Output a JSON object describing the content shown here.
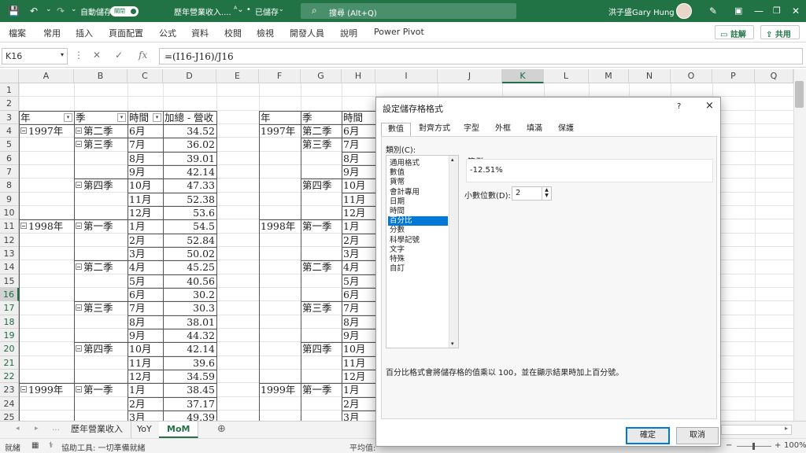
{
  "titlebar": {
    "autosave_label": "自動儲存",
    "autosave_state": "關閉",
    "doc_title": "歷年營業收入....",
    "saved_status": "已儲存",
    "search_placeholder": "搜尋 (Alt+Q)",
    "user_name": "洪子盛Gary Hung"
  },
  "ribbon": {
    "tabs": [
      "檔案",
      "常用",
      "插入",
      "頁面配置",
      "公式",
      "資料",
      "校閱",
      "檢視",
      "開發人員",
      "說明",
      "Power Pivot"
    ],
    "comments_label": "註解",
    "share_label": "共用"
  },
  "formula_bar": {
    "name_box": "K16",
    "formula": "=(I16-J16)/J16",
    "fx": "fx"
  },
  "columns": [
    "A",
    "B",
    "C",
    "D",
    "E",
    "F",
    "G",
    "H",
    "I",
    "J",
    "K",
    "L",
    "M",
    "N",
    "O",
    "P",
    "Q"
  ],
  "rows": [
    "1",
    "2",
    "3",
    "4",
    "5",
    "6",
    "7",
    "8",
    "9",
    "10",
    "11",
    "12",
    "13",
    "14",
    "15",
    "16",
    "17",
    "18",
    "19",
    "20",
    "21",
    "22",
    "23",
    "24",
    "25"
  ],
  "selected_cell": {
    "column": "K",
    "row": "16"
  },
  "pivot_left": {
    "headers": {
      "year": "年",
      "quarter": "季",
      "time": "時間",
      "sum": "加總 - 營收"
    },
    "years": [
      {
        "label": "1997年",
        "row": 4
      },
      {
        "label": "1998年",
        "row": 11
      },
      {
        "label": "1999年",
        "row": 23
      }
    ],
    "quarters": [
      {
        "label": "第二季",
        "row": 4
      },
      {
        "label": "第三季",
        "row": 5
      },
      {
        "label": "第四季",
        "row": 8
      },
      {
        "label": "第一季",
        "row": 11
      },
      {
        "label": "第二季",
        "row": 14
      },
      {
        "label": "第三季",
        "row": 17
      },
      {
        "label": "第四季",
        "row": 20
      },
      {
        "label": "第一季",
        "row": 23
      }
    ],
    "months": [
      "6月",
      "7月",
      "8月",
      "9月",
      "10月",
      "11月",
      "12月",
      "1月",
      "2月",
      "3月",
      "4月",
      "5月",
      "6月",
      "7月",
      "8月",
      "9月",
      "10月",
      "11月",
      "12月",
      "1月",
      "2月",
      "3月"
    ],
    "values": [
      "34.52",
      "36.02",
      "39.01",
      "42.14",
      "47.33",
      "52.38",
      "53.6",
      "54.5",
      "52.84",
      "50.02",
      "45.25",
      "40.56",
      "30.2",
      "30.3",
      "38.01",
      "44.32",
      "42.14",
      "39.6",
      "34.59",
      "38.45",
      "37.17",
      "49.39"
    ]
  },
  "pivot_right": {
    "headers": {
      "year": "年",
      "quarter": "季",
      "time": "時間"
    },
    "years": [
      {
        "label": "1997年",
        "row": 4
      },
      {
        "label": "1998年",
        "row": 11
      },
      {
        "label": "1999年",
        "row": 23
      }
    ],
    "quarters": [
      {
        "label": "第二季",
        "row": 4
      },
      {
        "label": "第三季",
        "row": 5
      },
      {
        "label": "第四季",
        "row": 8
      },
      {
        "label": "第一季",
        "row": 11
      },
      {
        "label": "第二季",
        "row": 14
      },
      {
        "label": "第三季",
        "row": 17
      },
      {
        "label": "第四季",
        "row": 20
      },
      {
        "label": "第一季",
        "row": 23
      }
    ],
    "months": [
      "6月",
      "7月",
      "8月",
      "9月",
      "10月",
      "11月",
      "12月",
      "1月",
      "2月",
      "3月",
      "4月",
      "5月",
      "6月",
      "7月",
      "8月",
      "9月",
      "10月",
      "11月",
      "12月",
      "1月",
      "2月",
      "3月"
    ]
  },
  "sheet_tabs": [
    "歷年營業收入",
    "YoY",
    "MoM"
  ],
  "active_sheet": "MoM",
  "status": {
    "ready": "就緒",
    "accessibility": "協助工具: 一切準備就緒",
    "average_label": "平均值:",
    "zoom": "100%"
  },
  "dialog": {
    "title": "設定儲存格格式",
    "help": "?",
    "close": "×",
    "tabs": [
      "數值",
      "對齊方式",
      "字型",
      "外框",
      "填滿",
      "保護"
    ],
    "active_tab": "數值",
    "category_label": "類別(C):",
    "categories": [
      "通用格式",
      "數值",
      "貨幣",
      "會計專用",
      "日期",
      "時間",
      "百分比",
      "分數",
      "科學記號",
      "文字",
      "特殊",
      "自訂"
    ],
    "selected_category": "百分比",
    "sample_label": "範例",
    "sample_value": "-12.51%",
    "decimals_label": "小數位數(D):",
    "decimals_value": "2",
    "description": "百分比格式會將儲存格的值乘以 100，並在顯示結果時加上百分號。",
    "ok": "確定",
    "cancel": "取消"
  }
}
